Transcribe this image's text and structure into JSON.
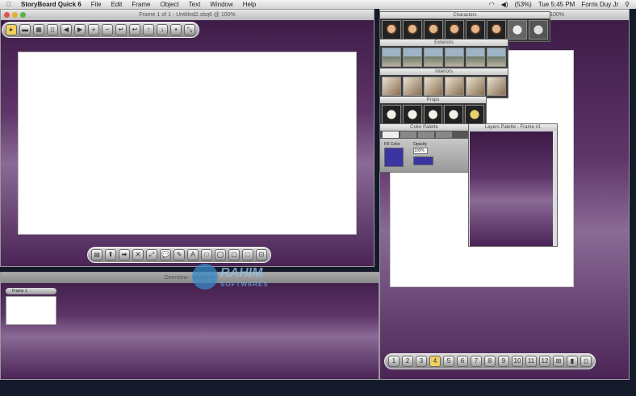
{
  "menubar": {
    "app": "StoryBoard Quick 6",
    "items": [
      "File",
      "Edit",
      "Frame",
      "Object",
      "Text",
      "Window",
      "Help"
    ],
    "status": {
      "battery": "(53%)",
      "clock": "Tue 5:45 PM",
      "user": "Forris Duy Jr"
    }
  },
  "main_window": {
    "title": "Frame 1 of 1 - Untitled2.sbq6 @ 100%",
    "toolbar": [
      "▸",
      "▬",
      "▦",
      "▯",
      "◀",
      "▶",
      "+",
      "−",
      "↵",
      "↩",
      "↑",
      "↓",
      "▪",
      "⤡"
    ],
    "bottom_toolbar": [
      "▤",
      "⬆",
      "➡",
      "✕",
      "⤢",
      "💬",
      "✎",
      "A",
      "□",
      "◯",
      "▢",
      "⬚",
      "⊡"
    ]
  },
  "overview_window": {
    "title": "Overview - Untitled2",
    "frame_label": "Frame 1"
  },
  "palettes": {
    "characters": "Characters",
    "exteriors": "Exteriors",
    "interiors": "Interiors",
    "props": "Props",
    "color_palette": {
      "title": "Color Palette",
      "fill_label": "Fill Color",
      "opacity_label": "Opacity",
      "opacity_value": "100%",
      "fill_color": "#3a35a0"
    },
    "layers_palette": "Layers Palette - Frame #1"
  },
  "right_window": {
    "title": "@ 100%",
    "bottom_toolbar": [
      "1",
      "2",
      "3",
      "4",
      "5",
      "6",
      "7",
      "8",
      "9",
      "10",
      "11",
      "12",
      "⊞",
      "▮",
      "▯"
    ]
  },
  "watermark": {
    "line1": "RAHIM",
    "line2": "SOFTWARES"
  }
}
